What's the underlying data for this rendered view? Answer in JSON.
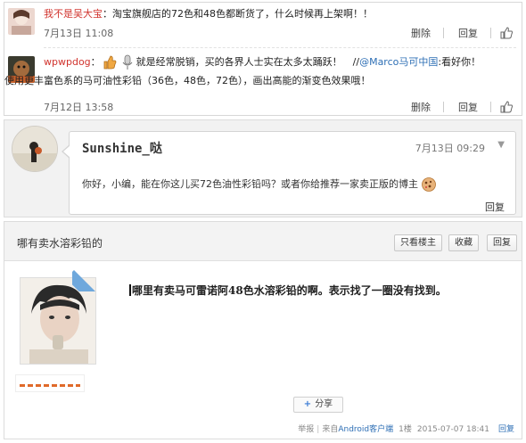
{
  "comment1": {
    "username": "我不是吴大宝",
    "text": "：淘宝旗舰店的72色和48色都断货了，什么时候再上架啊！！",
    "time": "7月13日 11:08",
    "delete_label": "删除",
    "reply_label": "回复"
  },
  "comment2": {
    "username": "wpwpdog",
    "colon": "：",
    "text_part1": "就是经常脱销，买的各界人士实在太多太踊跃！",
    "forward_sep": "//",
    "mention": "@Marco马可中国",
    "text_part2": ":看好你！",
    "line2": "使用更丰富色系的马可油性彩铅（36色，48色，72色），画出高能的渐变色效果哦！",
    "time": "7月12日 13:58",
    "delete_label": "删除",
    "reply_label": "回复"
  },
  "message": {
    "username": "Sunshine_哒",
    "time": "7月13日 09:29",
    "text": "你好，小编，能在你这儿买72色油性彩铅吗？或者你给推荐一家卖正版的博主",
    "reply_label": "回复"
  },
  "thread": {
    "title": "哪有卖水溶彩铅的",
    "btn_only_op": "只看楼主",
    "btn_collect": "收藏",
    "btn_reply": "回复",
    "badge": "楼主",
    "post_text": "哪里有卖马可雷诺阿48色水溶彩铅的啊。表示找了一圈没有找到。",
    "share_label": "分享",
    "footer": {
      "report": "举报",
      "from_prefix": "来自",
      "client": "Android客户端",
      "floor": "1楼",
      "datetime": "2015-07-07 18:41",
      "reply": "回复"
    }
  },
  "colors": {
    "username_red": "#d1342e",
    "link_blue": "#2e6fb5"
  }
}
